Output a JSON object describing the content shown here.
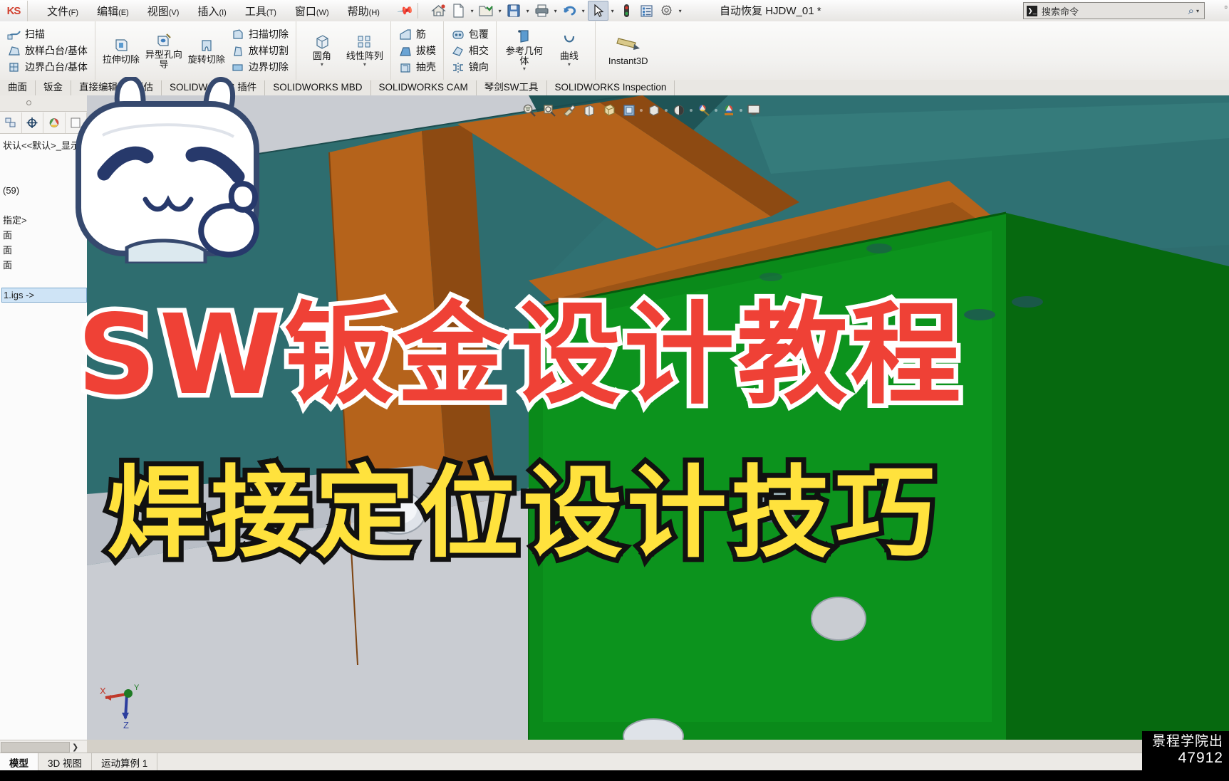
{
  "app": {
    "logo": "KS",
    "document_title_prefix": "自动恢复",
    "document_title": "HJDW_01 *"
  },
  "menubar": {
    "items": [
      {
        "label": "文件",
        "mnemonic": "(F)"
      },
      {
        "label": "编辑",
        "mnemonic": "(E)"
      },
      {
        "label": "视图",
        "mnemonic": "(V)"
      },
      {
        "label": "插入",
        "mnemonic": "(I)"
      },
      {
        "label": "工具",
        "mnemonic": "(T)"
      },
      {
        "label": "窗口",
        "mnemonic": "(W)"
      },
      {
        "label": "帮助",
        "mnemonic": "(H)"
      }
    ],
    "pin_icon": "pin-icon",
    "quick_access": [
      {
        "name": "home-icon",
        "glyph": "⌂"
      },
      {
        "name": "new-document-icon",
        "glyph": "▢"
      },
      {
        "name": "open-folder-icon",
        "glyph": "▤"
      },
      {
        "name": "save-icon",
        "glyph": "▣"
      },
      {
        "name": "print-icon",
        "glyph": "⎙"
      },
      {
        "name": "undo-icon",
        "glyph": "↶"
      },
      {
        "name": "select-arrow-icon",
        "glyph": "➤"
      },
      {
        "name": "rebuild-icon",
        "glyph": "❚"
      },
      {
        "name": "options-list-icon",
        "glyph": "▤"
      },
      {
        "name": "settings-gear-icon",
        "glyph": "⚙"
      }
    ]
  },
  "search": {
    "placeholder": "搜索命令",
    "icon": "search-icon",
    "prefix_icon": "console-icon",
    "caret": "▾"
  },
  "window_controls": {
    "label": "▫"
  },
  "ribbon": {
    "groups": [
      {
        "name": "features-left",
        "small_items": [
          {
            "label": "扫描",
            "icon": "sweep-icon"
          },
          {
            "label": "放样凸台/基体",
            "icon": "loft-boss-icon"
          },
          {
            "label": "边界凸台/基体",
            "icon": "boundary-boss-icon"
          }
        ]
      },
      {
        "name": "cut-features",
        "big_items": [
          {
            "label": "拉伸切除",
            "icon": "extruded-cut-icon"
          },
          {
            "label": "异型孔向导",
            "icon": "hole-wizard-icon"
          },
          {
            "label": "旋转切除",
            "icon": "revolved-cut-icon"
          }
        ],
        "small_items": [
          {
            "label": "扫描切除",
            "icon": "swept-cut-icon"
          },
          {
            "label": "放样切割",
            "icon": "lofted-cut-icon"
          },
          {
            "label": "边界切除",
            "icon": "boundary-cut-icon"
          }
        ]
      },
      {
        "name": "fillet-pattern",
        "big_items": [
          {
            "label": "圆角",
            "icon": "fillet-icon",
            "has_dropdown": true
          },
          {
            "label": "线性阵列",
            "icon": "linear-pattern-icon",
            "has_dropdown": true
          }
        ]
      },
      {
        "name": "rib-draft-shell",
        "small_items": [
          {
            "label": "筋",
            "icon": "rib-icon"
          },
          {
            "label": "拔模",
            "icon": "draft-icon"
          },
          {
            "label": "抽壳",
            "icon": "shell-icon"
          }
        ]
      },
      {
        "name": "wrap-intersect-mirror",
        "small_items": [
          {
            "label": "包覆",
            "icon": "wrap-icon"
          },
          {
            "label": "相交",
            "icon": "intersect-icon"
          },
          {
            "label": "镜向",
            "icon": "mirror-icon"
          }
        ]
      },
      {
        "name": "reference-curve",
        "big_items": [
          {
            "label": "参考几何体",
            "icon": "reference-geometry-icon",
            "has_dropdown": true
          },
          {
            "label": "曲线",
            "icon": "curves-icon",
            "has_dropdown": true
          }
        ]
      },
      {
        "name": "instant3d",
        "big_items": [
          {
            "label": "Instant3D",
            "icon": "instant3d-icon"
          }
        ]
      }
    ]
  },
  "command_tabs": [
    {
      "label": "曲面",
      "active": false
    },
    {
      "label": "钣金",
      "active": false
    },
    {
      "label": "直接编辑",
      "active": false
    },
    {
      "label": "评估",
      "active": false
    },
    {
      "label": "SOLIDWORKS 插件",
      "active": false
    },
    {
      "label": "SOLIDWORKS MBD",
      "active": false
    },
    {
      "label": "SOLIDWORKS CAM",
      "active": false
    },
    {
      "label": "琴剑SW工具",
      "active": false
    },
    {
      "label": "SOLIDWORKS Inspection",
      "active": false
    }
  ],
  "left_panel": {
    "tab_icons": [
      {
        "name": "feature-tree-icon",
        "glyph": "▤"
      },
      {
        "name": "property-manager-icon",
        "glyph": "▦"
      },
      {
        "name": "configuration-icon",
        "glyph": "✥"
      },
      {
        "name": "display-manager-icon",
        "glyph": "◕"
      }
    ],
    "tree_items": [
      {
        "label": "状认<<默认>_显示",
        "selected": false
      },
      {
        "label": "(59)",
        "selected": false
      },
      {
        "label": "指定>",
        "selected": false
      },
      {
        "label": "面",
        "selected": false
      },
      {
        "label": "面",
        "selected": false
      },
      {
        "label": "面",
        "selected": false
      },
      {
        "label": "1.igs ->",
        "selected": true
      }
    ]
  },
  "viewport": {
    "view_toolbar": [
      {
        "name": "zoom-to-fit-icon",
        "glyph": "⊕"
      },
      {
        "name": "zoom-to-area-icon",
        "glyph": "⊡"
      },
      {
        "name": "previous-view-icon",
        "glyph": "↩"
      },
      {
        "name": "section-view-icon",
        "glyph": "◫"
      },
      {
        "name": "view-orientation-icon",
        "glyph": "◩"
      },
      {
        "name": "display-style-icon",
        "glyph": "▣"
      },
      {
        "name": "hide-show-items-icon",
        "glyph": "◻"
      },
      {
        "name": "edit-appearance-icon",
        "glyph": "◐"
      },
      {
        "name": "apply-scene-icon",
        "glyph": "◉"
      },
      {
        "name": "view-settings-icon",
        "glyph": "◍"
      },
      {
        "name": "viewport-layout-icon",
        "glyph": "▭"
      }
    ],
    "triad": {
      "x_label": "X",
      "y_label": "Y",
      "z_label": "Z"
    }
  },
  "bottom_tabs": [
    {
      "label": "模型",
      "active": true
    },
    {
      "label": "3D 视图",
      "active": false
    },
    {
      "label": "运动算例 1",
      "active": false
    }
  ],
  "scrollbar": {
    "arrow": "❯"
  },
  "overlay": {
    "headline": "SW钣金设计教程",
    "subtitle": "焊接定位设计技巧",
    "headline_color": "#ef4136",
    "headline_stroke": "#ffffff",
    "subtitle_color": "#ffe23d",
    "subtitle_stroke": "#111111"
  },
  "mascot": {
    "name": "cartoon-rabbit-mascot"
  },
  "watermark": {
    "line1": "景程学院出",
    "line2": "47912"
  }
}
